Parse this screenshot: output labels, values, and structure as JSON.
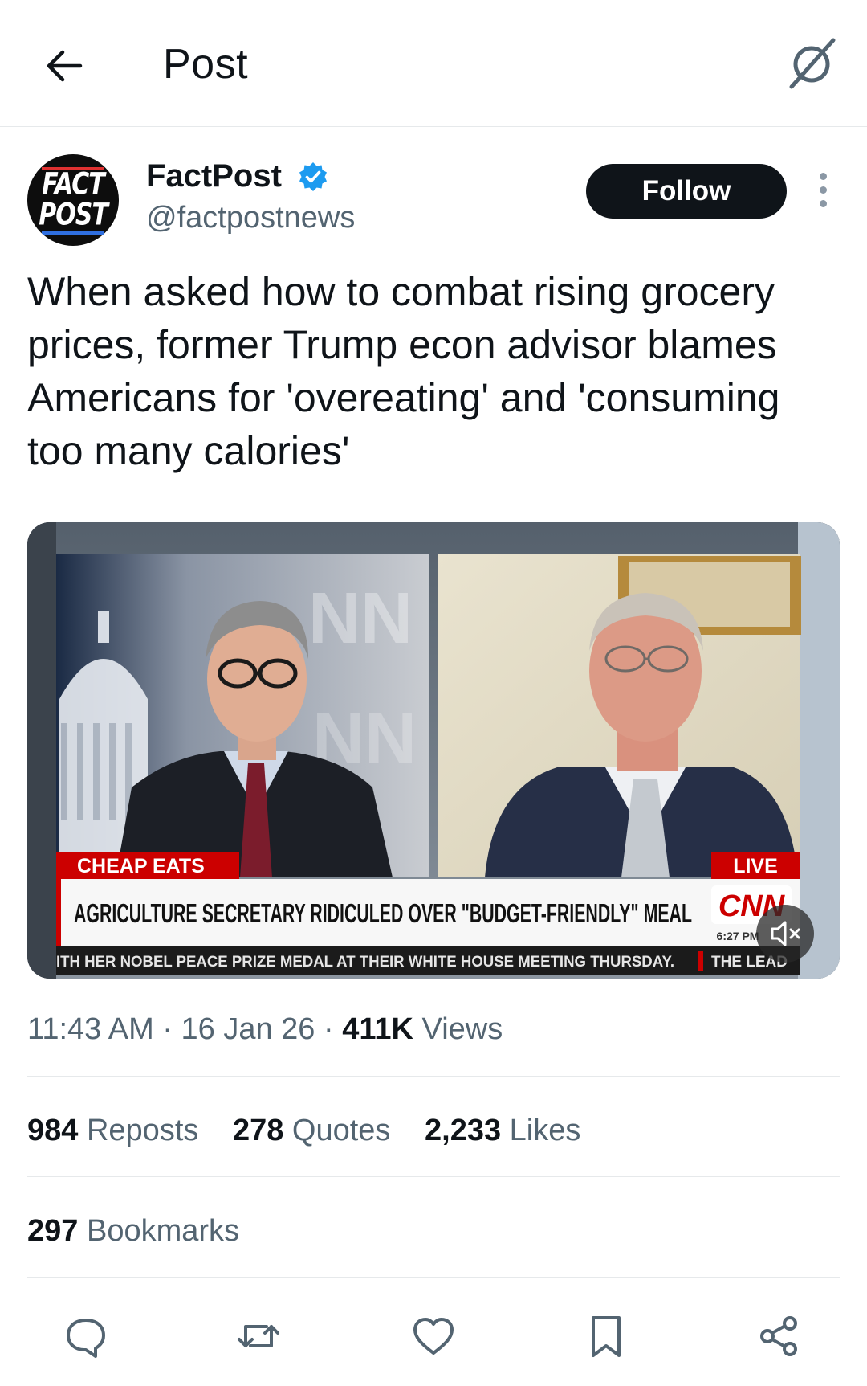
{
  "header": {
    "title": "Post"
  },
  "author": {
    "display_name": "FactPost",
    "handle": "@factpostnews",
    "avatar_text_1": "FACT",
    "avatar_text_2": "POST",
    "verified": true
  },
  "follow_label": "Follow",
  "tweet": {
    "text": "When asked how to combat rising grocery prices, former Trump econ advisor blames Americans for 'overeating' and 'consuming too many calories'"
  },
  "video": {
    "segment_label": "CHEAP EATS",
    "live_label": "LIVE",
    "headline": "AGRICULTURE SECRETARY RIDICULED OVER \"BUDGET-FRIENDLY\" MEAL",
    "network": "CNN",
    "time": "6:27 PM",
    "ticker": "ITH HER NOBEL PEACE PRIZE MEDAL AT THEIR WHITE HOUSE MEETING THURSDAY.",
    "show": "THE LEAD",
    "muted": true
  },
  "meta": {
    "time": "11:43 AM",
    "date": "16 Jan 26",
    "views_count": "411K",
    "views_label": "Views",
    "separator": "·"
  },
  "stats": {
    "reposts_count": "984",
    "reposts_label": "Reposts",
    "quotes_count": "278",
    "quotes_label": "Quotes",
    "likes_count": "2,233",
    "likes_label": "Likes",
    "bookmarks_count": "297",
    "bookmarks_label": "Bookmarks"
  },
  "actions": [
    "reply-icon",
    "repost-icon",
    "like-icon",
    "bookmark-icon",
    "share-icon"
  ],
  "colors": {
    "text": "#0f1419",
    "muted": "#536471",
    "verified": "#1d9bf0",
    "divider": "#e6e9eb",
    "cnn_red": "#cc0000"
  }
}
